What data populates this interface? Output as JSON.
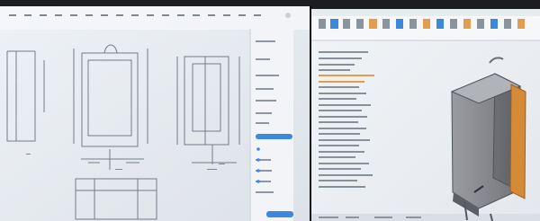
{
  "scene": {
    "kind": "photo",
    "description_items": [
      "two-monitors",
      "cad-drawing-window",
      "cad-3d-model-window",
      "right-side-panel",
      "feature-tree",
      "3d-cabinet-model"
    ]
  },
  "left_monitor": {
    "labels": {
      "corner_note": "",
      "panel_button": ""
    }
  },
  "right_monitor": {
    "labels": {
      "tree_header": ""
    }
  },
  "colors": {
    "bezel": "#1c1d20",
    "screen_left": "#e9edf2",
    "screen_right": "#eceff3",
    "line": "#7f8793",
    "accent_blue": "#3d88df",
    "accent_orange": "#e39d4f",
    "model_gray": "#86898f",
    "model_dark": "#57595f",
    "model_orange": "#d58a38"
  }
}
